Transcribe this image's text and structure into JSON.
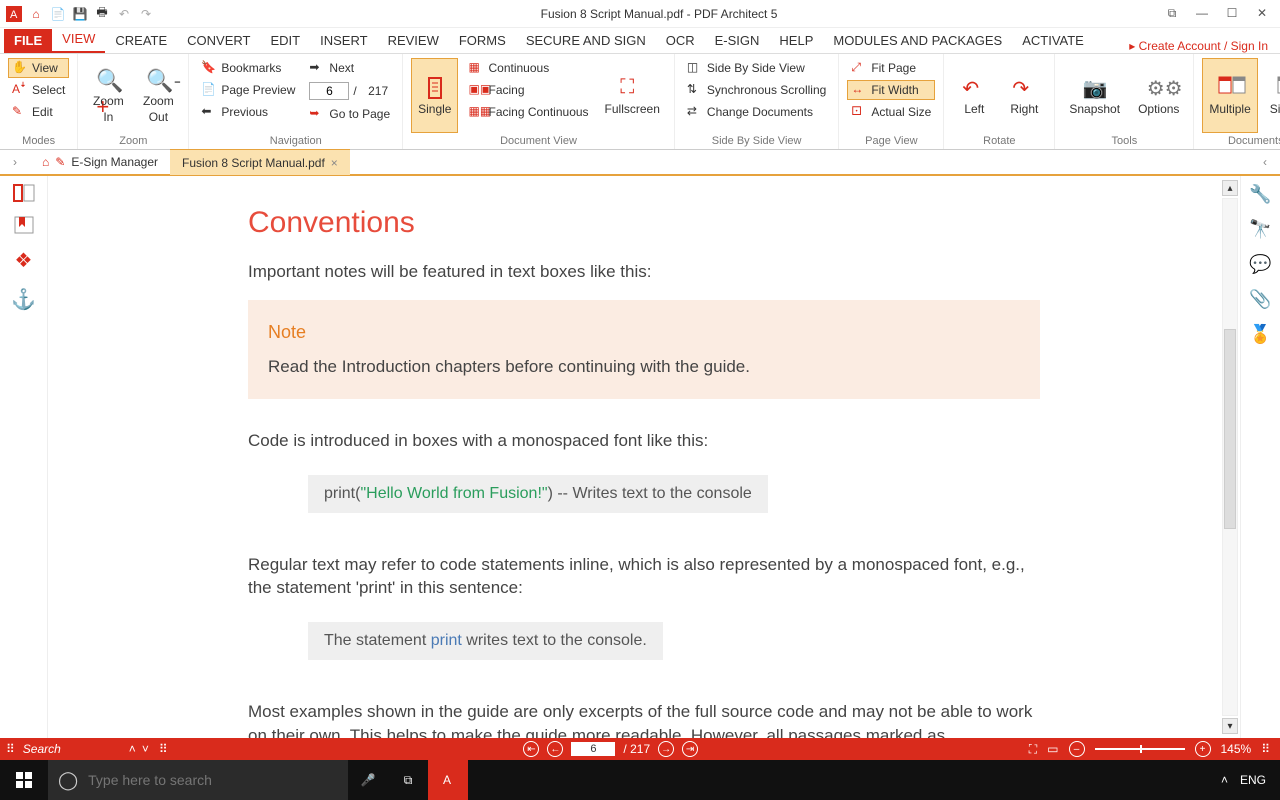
{
  "titlebar": {
    "title": "Fusion 8 Script Manual.pdf    -    PDF Architect 5"
  },
  "link_signin": "Create Account / Sign In",
  "ribbon_tabs": {
    "file": "FILE",
    "view": "VIEW",
    "create": "CREATE",
    "convert": "CONVERT",
    "edit": "EDIT",
    "insert": "INSERT",
    "review": "REVIEW",
    "forms": "FORMS",
    "secure": "SECURE AND SIGN",
    "ocr": "OCR",
    "esign": "E-SIGN",
    "help": "HELP",
    "modules": "MODULES AND PACKAGES",
    "activate": "ACTIVATE"
  },
  "modes": {
    "view": "View",
    "select": "Select",
    "edit": "Edit",
    "label": "Modes"
  },
  "zoom": {
    "in_l1": "Zoom",
    "in_l2": "In",
    "out_l1": "Zoom",
    "out_l2": "Out",
    "label": "Zoom"
  },
  "nav": {
    "bookmarks": "Bookmarks",
    "page_preview": "Page Preview",
    "previous": "Previous",
    "next": "Next",
    "goto": "Go to Page",
    "page_value": "6",
    "page_sep": "/",
    "page_total": "217",
    "label": "Navigation"
  },
  "docview": {
    "single": "Single",
    "continuous": "Continuous",
    "facing": "Facing",
    "facing_cont": "Facing Continuous",
    "fullscreen": "Fullscreen",
    "label": "Document View"
  },
  "sbs": {
    "sidebyside": "Side By Side View",
    "sync": "Synchronous Scrolling",
    "change": "Change Documents",
    "label": "Side By Side View"
  },
  "pageview": {
    "fitpage": "Fit Page",
    "fitwidth": "Fit Width",
    "actual": "Actual Size",
    "label": "Page View"
  },
  "rotate": {
    "left": "Left",
    "right": "Right",
    "label": "Rotate"
  },
  "tools": {
    "snapshot": "Snapshot",
    "options": "Options",
    "label": "Tools"
  },
  "documents": {
    "multiple": "Multiple",
    "single": "Single",
    "label": "Documents"
  },
  "doc_tabs": {
    "esign": "E-Sign Manager",
    "file": "Fusion 8 Script Manual.pdf"
  },
  "page": {
    "h1": "Conventions",
    "p1": "Important notes will be featured in text boxes like this:",
    "note_t": "Note",
    "note_b": "Read the Introduction chapters before continuing with the guide.",
    "p2": "Code is introduced in boxes with a monospaced font like this:",
    "code1_a": "print(",
    "code1_b": "\"Hello World from Fusion!\"",
    "code1_c": ")   -- Writes text to the console",
    "p3": "Regular text may refer to code statements inline, which is also represented by a monospaced font, e.g., the statement 'print' in this sentence:",
    "code2_a": "The statement ",
    "code2_b": "print",
    "code2_c": " writes text to the console.",
    "p4": "Most examples shown in the guide are only excerpts of the full source code and may not be able to work on their own. This helps to make the guide more readable. However, all passages marked as"
  },
  "statusbar": {
    "search_ph": "Search",
    "page_value": "6",
    "page_total": "/ 217",
    "zoom_pct": "145%"
  },
  "taskbar": {
    "search_ph": "Type here to search",
    "lang": "ENG"
  }
}
